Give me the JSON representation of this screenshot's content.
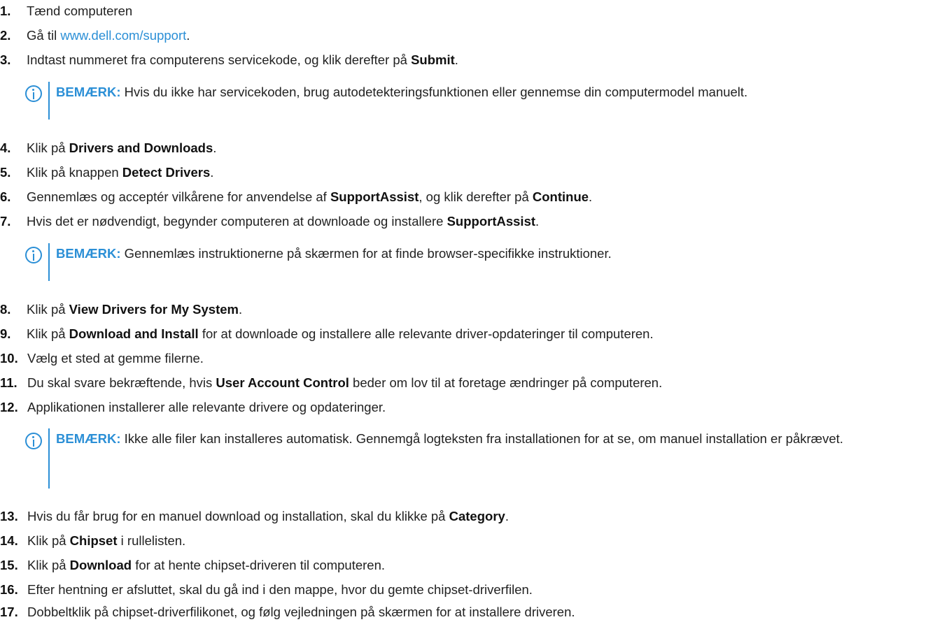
{
  "steps": [
    {
      "num": "1.",
      "text": "Tænd computeren"
    },
    {
      "num": "2.",
      "pre": "Gå til ",
      "link": "www.dell.com/support",
      "post": "."
    },
    {
      "num": "3.",
      "pre": "Indtast nummeret fra computerens servicekode, og klik derefter på ",
      "bold": "Submit",
      "post": "."
    },
    {
      "num": "4.",
      "pre": "Klik på ",
      "bold": "Drivers and Downloads",
      "post": "."
    },
    {
      "num": "5.",
      "pre": "Klik på knappen ",
      "bold": "Detect Drivers",
      "post": "."
    },
    {
      "num": "6.",
      "pre": "Gennemlæs og acceptér vilkårene for anvendelse af ",
      "bold": "SupportAssist",
      "mid": ", og klik derefter på ",
      "bold2": "Continue",
      "post": "."
    },
    {
      "num": "7.",
      "pre": "Hvis det er nødvendigt, begynder computeren at downloade og installere ",
      "bold": "SupportAssist",
      "post": "."
    },
    {
      "num": "8.",
      "pre": "Klik på ",
      "bold": "View Drivers for My System",
      "post": "."
    },
    {
      "num": "9.",
      "pre": "Klik på ",
      "bold": "Download and Install",
      "post": " for at downloade og installere alle relevante driver-opdateringer til computeren."
    },
    {
      "num": "10.",
      "text": "Vælg et sted at gemme filerne."
    },
    {
      "num": "11.",
      "pre": "Du skal svare bekræftende, hvis ",
      "bold": "User Account Control",
      "post": " beder om lov til at foretage ændringer på computeren."
    },
    {
      "num": "12.",
      "text": "Applikationen installerer alle relevante drivere og opdateringer."
    },
    {
      "num": "13.",
      "pre": "Hvis du får brug for en manuel download og installation, skal du klikke på ",
      "bold": "Category",
      "post": "."
    },
    {
      "num": "14.",
      "pre": "Klik på ",
      "bold": "Chipset",
      "post": " i rullelisten."
    },
    {
      "num": "15.",
      "pre": "Klik på ",
      "bold": "Download",
      "post": " for at hente chipset-driveren til computeren."
    },
    {
      "num": "16.",
      "text": "Efter hentning er afsluttet, skal du gå ind i den mappe, hvor du gemte chipset-driverfilen."
    },
    {
      "num": "17.",
      "text": "Dobbeltklik på chipset-driverfilikonet, og følg vejledningen på skærmen for at installere driveren."
    }
  ],
  "notes": [
    {
      "label": "BEMÆRK:",
      "text": "Hvis du ikke har servicekoden, brug autodetekteringsfunktionen eller gennemse din computermodel manuelt."
    },
    {
      "label": "BEMÆRK:",
      "text": "Gennemlæs instruktionerne på skærmen for at finde browser-specifikke instruktioner."
    },
    {
      "label": "BEMÆRK:",
      "text": "Ikke alle filer kan installeres automatisk. Gennemgå logteksten fra installationen for at se, om manuel installation er påkrævet."
    }
  ],
  "colors": {
    "accent": "#2b8fd6",
    "text": "#222222"
  },
  "icons": {
    "note": "info-circle-icon"
  }
}
